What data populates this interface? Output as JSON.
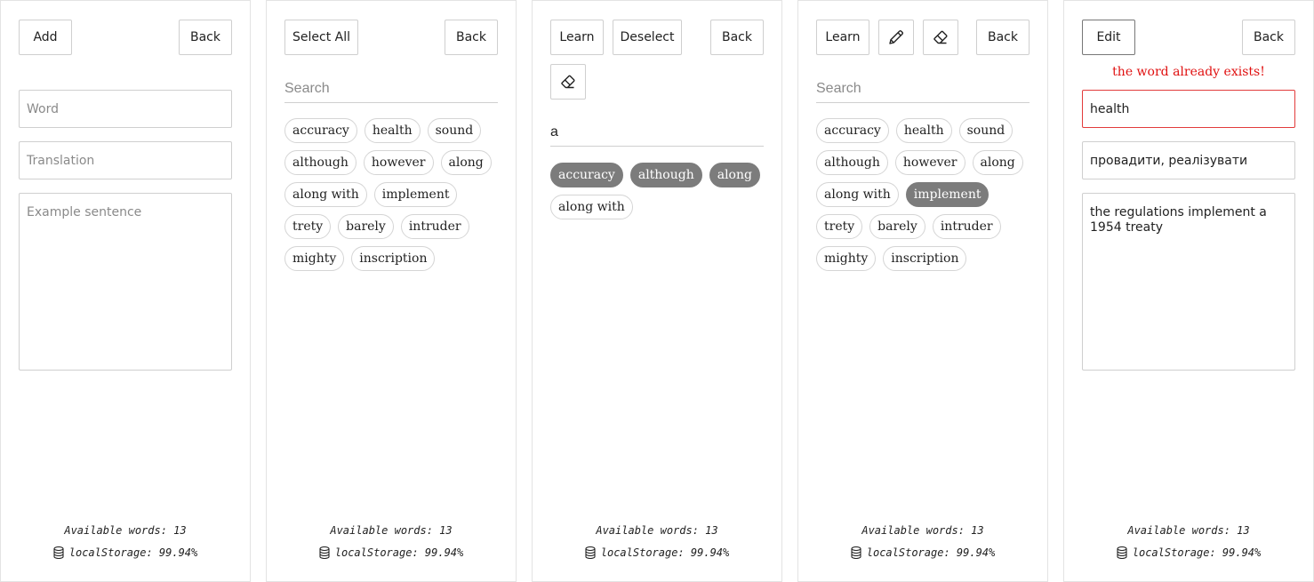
{
  "footer": {
    "available": "Available words: 13",
    "storage": "localStorage: 99.94%"
  },
  "panel1": {
    "add_label": "Add",
    "back_label": "Back",
    "word_placeholder": "Word",
    "translation_placeholder": "Translation",
    "example_placeholder": "Example sentence"
  },
  "panel2": {
    "select_all_label": "Select All",
    "back_label": "Back",
    "search_placeholder": "Search",
    "words": [
      "accuracy",
      "health",
      "sound",
      "although",
      "however",
      "along",
      "along with",
      "implement",
      "trety",
      "barely",
      "intruder",
      "mighty",
      "inscription"
    ]
  },
  "panel3": {
    "learn_label": "Learn",
    "deselect_label": "Deselect",
    "back_label": "Back",
    "eraser_icon": "eraser-icon",
    "search_value": "a",
    "words": [
      {
        "label": "accuracy",
        "selected": true
      },
      {
        "label": "although",
        "selected": true
      },
      {
        "label": "along",
        "selected": true
      },
      {
        "label": "along with",
        "selected": false
      }
    ]
  },
  "panel4": {
    "learn_label": "Learn",
    "pencil_icon": "pencil-icon",
    "eraser_icon": "eraser-icon",
    "back_label": "Back",
    "search_placeholder": "Search",
    "words": [
      {
        "label": "accuracy",
        "selected": false
      },
      {
        "label": "health",
        "selected": false
      },
      {
        "label": "sound",
        "selected": false
      },
      {
        "label": "although",
        "selected": false
      },
      {
        "label": "however",
        "selected": false
      },
      {
        "label": "along",
        "selected": false
      },
      {
        "label": "along with",
        "selected": false
      },
      {
        "label": "implement",
        "selected": true
      },
      {
        "label": "trety",
        "selected": false
      },
      {
        "label": "barely",
        "selected": false
      },
      {
        "label": "intruder",
        "selected": false
      },
      {
        "label": "mighty",
        "selected": false
      },
      {
        "label": "inscription",
        "selected": false
      }
    ]
  },
  "panel5": {
    "edit_label": "Edit",
    "back_label": "Back",
    "error_message": "the word already exists!",
    "word_value": "health",
    "translation_value": "провадити, реалізувати",
    "example_value": "the regulations implement a\n1954 treaty"
  },
  "colors": {
    "chip_selected": "#7c7c7c",
    "error": "#e01010"
  }
}
